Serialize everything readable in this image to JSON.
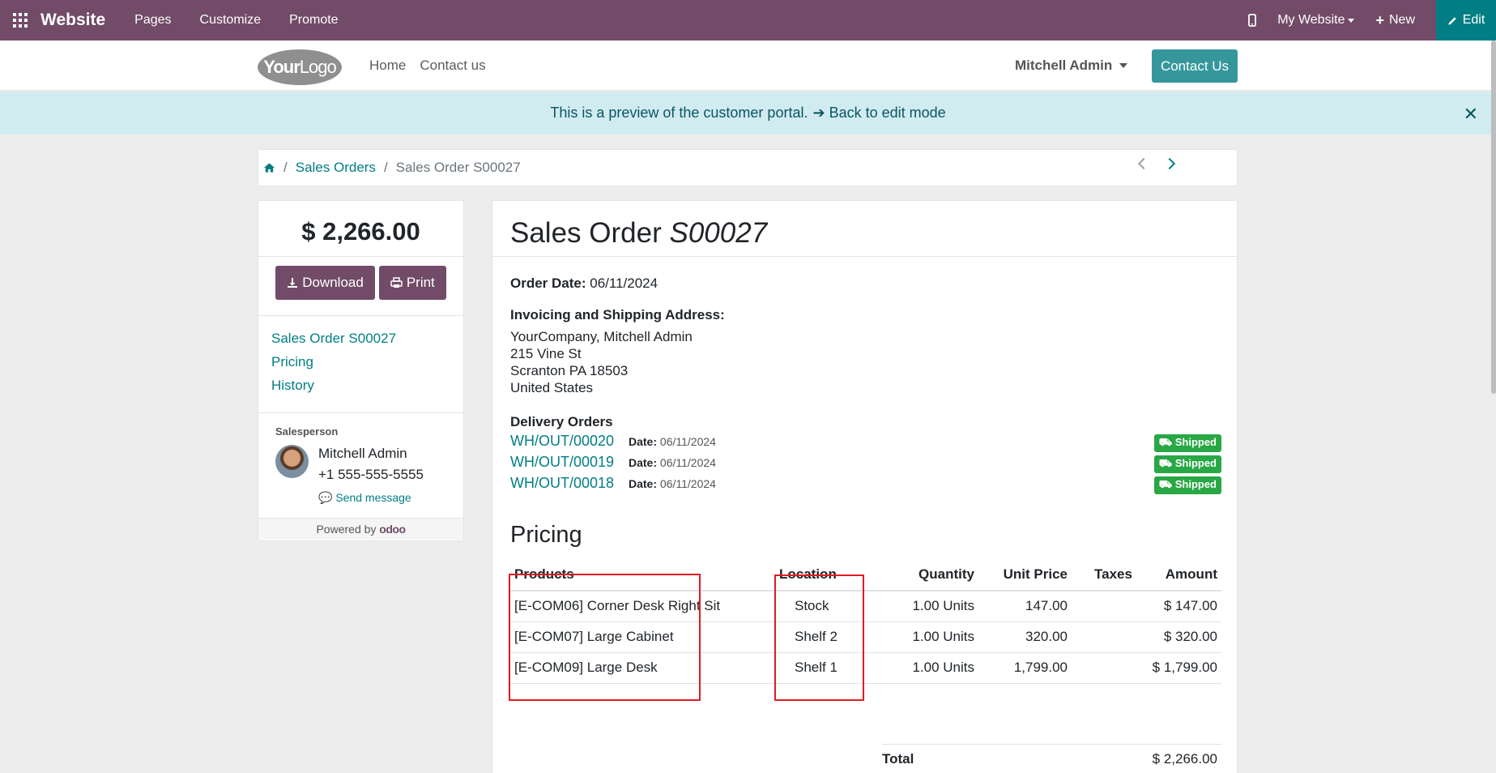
{
  "topbar": {
    "brand": "Website",
    "menus": [
      "Pages",
      "Customize",
      "Promote"
    ],
    "site_selector": "My Website",
    "new_label": "New",
    "edit_label": "Edit"
  },
  "header": {
    "logo_bold": "Your",
    "logo_light": "Logo",
    "nav": [
      "Home",
      "Contact us"
    ],
    "user": "Mitchell Admin",
    "contact_button": "Contact Us"
  },
  "banner": {
    "text": "This is a preview of the customer portal.",
    "link": "Back to edit mode"
  },
  "breadcrumb": {
    "sales_orders": "Sales Orders",
    "current": "Sales Order S00027"
  },
  "sidebar": {
    "amount": "$ 2,266.00",
    "download": "Download",
    "print": "Print",
    "links": [
      "Sales Order S00027",
      "Pricing",
      "History"
    ],
    "salesperson_label": "Salesperson",
    "salesperson_name": "Mitchell Admin",
    "salesperson_phone": "+1 555-555-5555",
    "send_message": "Send message",
    "powered_by": "Powered by",
    "odoo": "odoo"
  },
  "order": {
    "title_prefix": "Sales Order",
    "title_number": "S00027",
    "order_date_label": "Order Date:",
    "order_date": "06/11/2024",
    "address_label": "Invoicing and Shipping Address:",
    "address": [
      "YourCompany, Mitchell Admin",
      "215 Vine St",
      "Scranton PA 18503",
      "United States"
    ],
    "delivery_label": "Delivery Orders",
    "deliveries": [
      {
        "ref": "WH/OUT/00020",
        "date_label": "Date:",
        "date": "06/11/2024",
        "status": "Shipped"
      },
      {
        "ref": "WH/OUT/00019",
        "date_label": "Date:",
        "date": "06/11/2024",
        "status": "Shipped"
      },
      {
        "ref": "WH/OUT/00018",
        "date_label": "Date:",
        "date": "06/11/2024",
        "status": "Shipped"
      }
    ],
    "pricing_title": "Pricing",
    "columns": [
      "Products",
      "Location",
      "Quantity",
      "Unit Price",
      "Taxes",
      "Amount"
    ],
    "lines": [
      {
        "product": "[E-COM06] Corner Desk Right Sit",
        "location": "Stock",
        "qty": "1.00 Units",
        "price": "147.00",
        "taxes": "",
        "amount": "$ 147.00"
      },
      {
        "product": "[E-COM07] Large Cabinet",
        "location": "Shelf 2",
        "qty": "1.00 Units",
        "price": "320.00",
        "taxes": "",
        "amount": "$ 320.00"
      },
      {
        "product": "[E-COM09] Large Desk",
        "location": "Shelf 1",
        "qty": "1.00 Units",
        "price": "1,799.00",
        "taxes": "",
        "amount": "$ 1,799.00"
      }
    ],
    "total_label": "Total",
    "total_value": "$ 2,266.00"
  },
  "colors": {
    "topbar": "#714b67",
    "edit": "#017e84",
    "link": "#017e84",
    "shipped": "#28a745",
    "highlight": "#e01b24"
  }
}
